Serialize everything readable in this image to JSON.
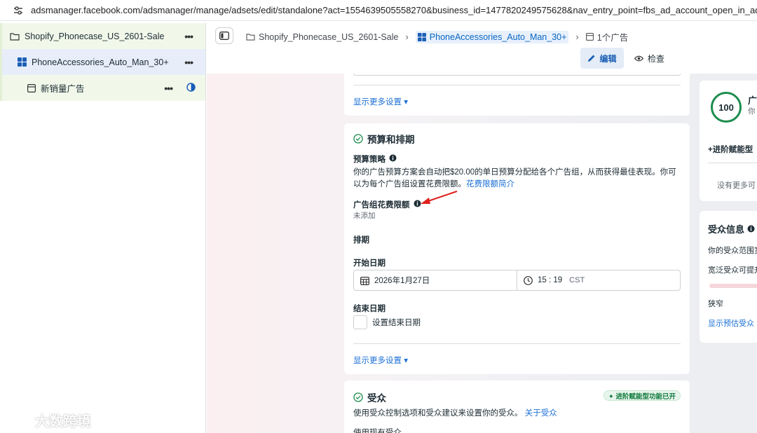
{
  "browser": {
    "url": "adsmanager.facebook.com/adsmanager/manage/adsets/edit/standalone?act=1554639505558270&business_id=1477820249575628&nav_entry_point=fbs_ad_account_open_in_ads_manag",
    "icon": "tune-icon"
  },
  "tree": {
    "campaign": "Shopify_Phonecase_US_2601-Sale",
    "adset": "PhoneAccessories_Auto_Man_30+",
    "ad": "新销量广告",
    "more": "•••"
  },
  "header": {
    "crumb_campaign": "Shopify_Phonecase_US_2601-Sale",
    "crumb_adset": "PhoneAccessories_Auto_Man_30+",
    "crumb_ad": "1个广告",
    "edit_label": "编辑",
    "view_label": "检查"
  },
  "top_card": {
    "more_settings": "显示更多设置 ▾"
  },
  "budget": {
    "title": "预算和排期",
    "strategy_label": "预算策略",
    "strategy_desc": "你的广告预算方案会自动把$20.00的单日预算分配给各个广告组，从而获得最佳表现。你可以为每个广告组设置花费限额。",
    "strategy_link": "花费限额简介",
    "limit_label": "广告组花费限额",
    "limit_value": "未添加",
    "schedule_label": "排期",
    "start_label": "开始日期",
    "start_date": "2026年1月27日",
    "start_time": "15 : 19",
    "timezone": "CST",
    "end_label": "结束日期",
    "end_checkbox": "设置结束日期",
    "more_settings": "显示更多设置 ▾"
  },
  "audience": {
    "title": "受众",
    "badge": "✦ 进阶赋能型功能已开",
    "desc": "使用受众控制选项和受众建议来设置你的受众。",
    "link": "关于受众",
    "cut_text": "使用现有受众"
  },
  "right": {
    "score": "100",
    "title": "广",
    "subtitle": "你",
    "advantage": "+进阶赋能型",
    "no_more": "没有更多可",
    "aud_title": "受众信息",
    "aud_line1": "你的受众范围宽",
    "aud_line2": "宽泛受众可提升",
    "narrow": "狭窄",
    "show_est": "显示预估受众"
  },
  "watermark": "大数跨境",
  "colors": {
    "accent": "#1a6fd6",
    "success": "#1e8d4e",
    "annotation_arrow": "#e0201b"
  }
}
